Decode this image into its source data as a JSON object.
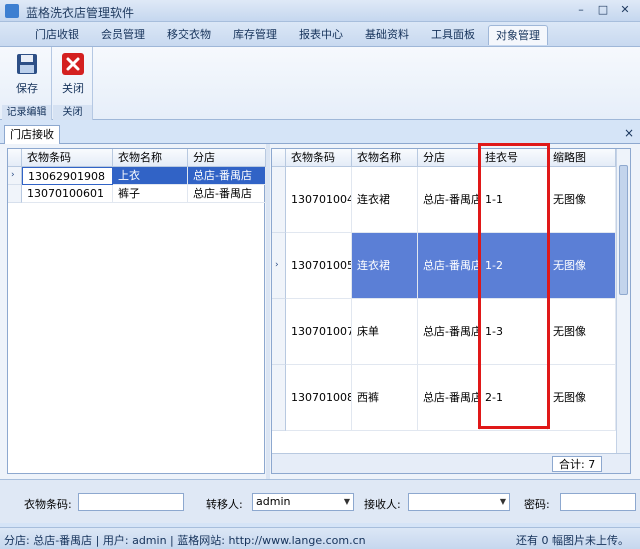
{
  "window": {
    "title": "蓝格洗衣店管理软件",
    "minimize": "–",
    "maximize": "□",
    "close": "✕"
  },
  "menu": {
    "tabs": [
      "门店收银",
      "会员管理",
      "移交衣物",
      "库存管理",
      "报表中心",
      "基础资料",
      "工具面板",
      "对象管理"
    ],
    "active": "对象管理"
  },
  "ribbon": {
    "save_label": "保存",
    "close_label": "关闭",
    "group_record": "记录编辑",
    "group_close": "关闭"
  },
  "doc_tab": {
    "label": "门店接收",
    "close": "×"
  },
  "left_grid": {
    "columns": [
      "衣物条码",
      "衣物名称",
      "分店"
    ],
    "rows": [
      [
        "13062901908",
        "上衣",
        "总店-番禺店"
      ],
      [
        "13070100601",
        "裤子",
        "总店-番禺店"
      ]
    ]
  },
  "right_grid": {
    "columns": [
      "衣物条码",
      "衣物名称",
      "分店",
      "挂衣号",
      "缩略图"
    ],
    "rows": [
      [
        "130701004...",
        "连衣裙",
        "总店-番禺店",
        "1-1",
        "无图像"
      ],
      [
        "130701005...",
        "连衣裙",
        "总店-番禺店",
        "1-2",
        "无图像"
      ],
      [
        "130701007...",
        "床单",
        "总店-番禺店",
        "1-3",
        "无图像"
      ],
      [
        "130701008...",
        "西裤",
        "总店-番禺店",
        "2-1",
        "无图像"
      ]
    ],
    "total": "合计: 7"
  },
  "form": {
    "barcode_label": "衣物条码:",
    "barcode_value": "",
    "transfer_label": "转移人:",
    "transfer_value": "admin",
    "receiver_label": "接收人:",
    "receiver_value": "",
    "password_label": "密码:",
    "password_value": ""
  },
  "status": {
    "left": "分店: 总店-番禺店 | 用户: admin | 蓝格网站: http://www.lange.com.cn",
    "right": "还有 0 幅图片未上传。"
  },
  "colors": {
    "highlight_box": "#e01818",
    "selection": "#3163c6"
  }
}
